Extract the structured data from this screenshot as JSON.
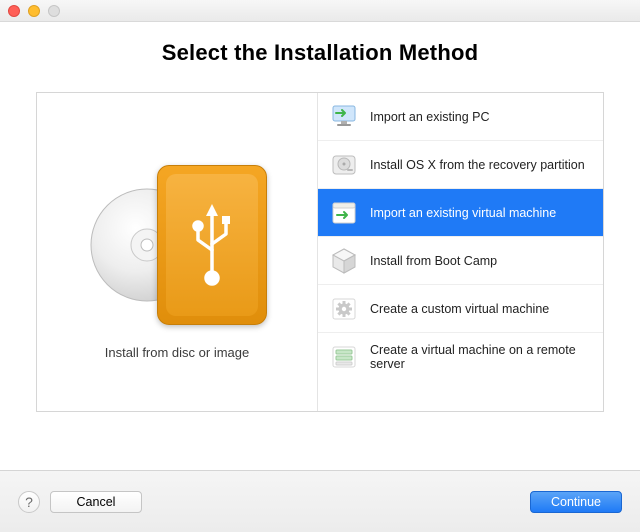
{
  "header": {
    "title": "Select the Installation Method"
  },
  "left": {
    "label": "Install from disc or image"
  },
  "options": [
    {
      "label": "Import an existing PC",
      "selected": false
    },
    {
      "label": "Install OS X from the recovery partition",
      "selected": false
    },
    {
      "label": "Import an existing virtual machine",
      "selected": true
    },
    {
      "label": "Install from Boot Camp",
      "selected": false
    },
    {
      "label": "Create a custom virtual machine",
      "selected": false
    },
    {
      "label": "Create a virtual machine on a remote server",
      "selected": false
    }
  ],
  "footer": {
    "help": "?",
    "cancel": "Cancel",
    "continue": "Continue"
  }
}
